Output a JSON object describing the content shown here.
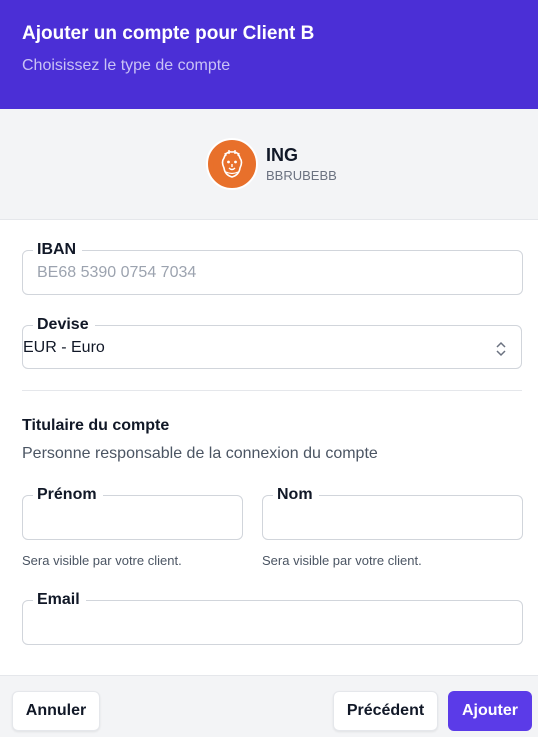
{
  "header": {
    "title": "Ajouter un compte pour Client B",
    "subtitle": "Choisissez le type de compte"
  },
  "bank": {
    "name": "ING",
    "bic": "BBRUBEBB",
    "logo_icon": "ing-lion-icon",
    "logo_color": "#e8702b"
  },
  "form": {
    "iban": {
      "label": "IBAN",
      "placeholder": "BE68 5390 0754 7034",
      "value": ""
    },
    "currency": {
      "label": "Devise",
      "selected": "EUR - Euro"
    },
    "holder": {
      "title": "Titulaire du compte",
      "description": "Personne responsable de la connexion du compte",
      "first_name": {
        "label": "Prénom",
        "value": "",
        "help": "Sera visible par votre client."
      },
      "last_name": {
        "label": "Nom",
        "value": "",
        "help": "Sera visible par votre client."
      },
      "email": {
        "label": "Email",
        "value": ""
      }
    }
  },
  "footer": {
    "cancel_label": "Annuler",
    "previous_label": "Précédent",
    "submit_label": "Ajouter"
  },
  "colors": {
    "header_bg": "#4b2fd6",
    "primary_button": "#5b3be8",
    "ing_orange": "#e8702b"
  }
}
